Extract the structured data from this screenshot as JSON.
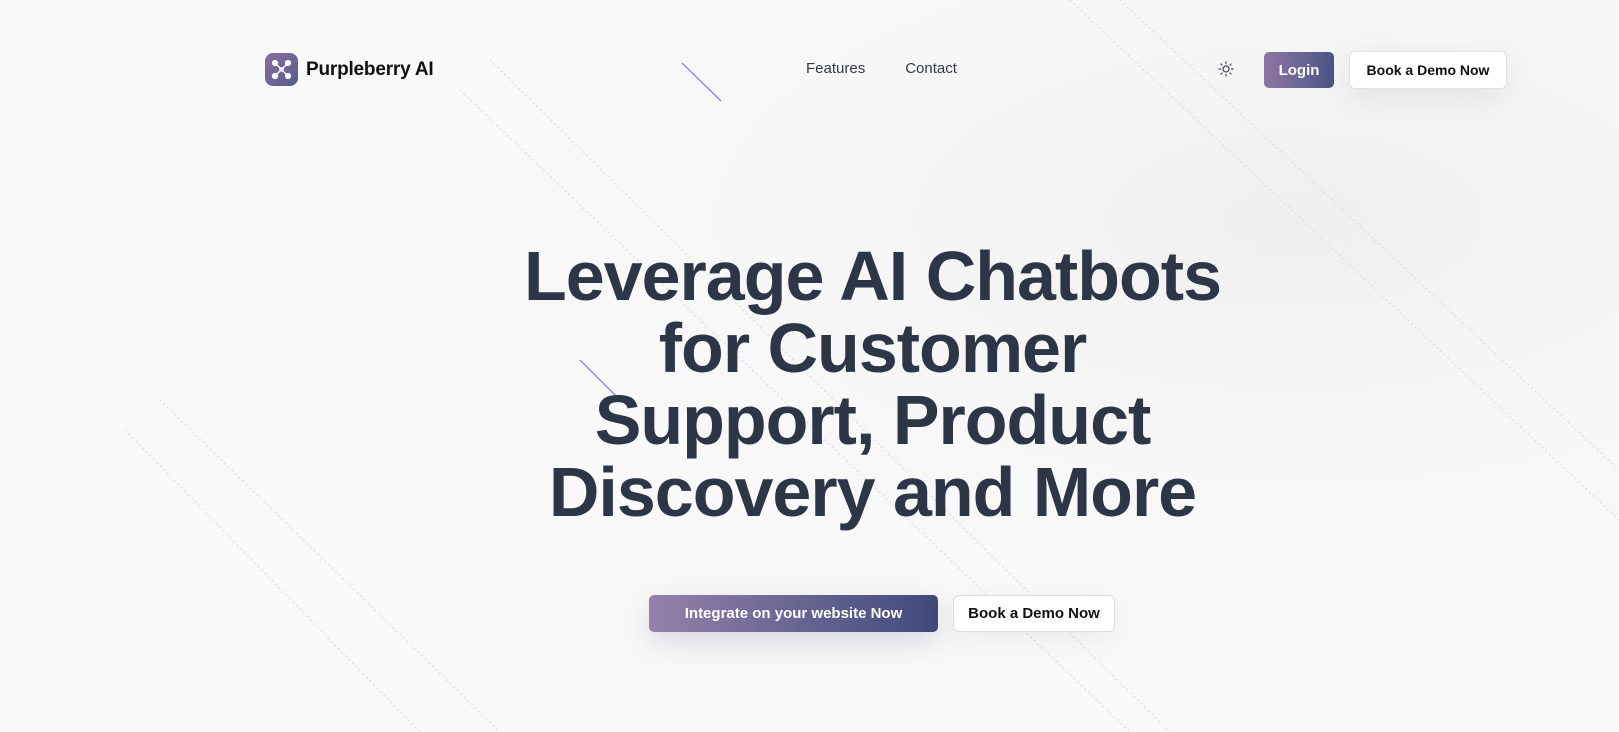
{
  "nav": {
    "brand_name": "Purpleberry AI",
    "logo_icon": "network-nodes-icon",
    "links": [
      {
        "label": "Features"
      },
      {
        "label": "Contact"
      }
    ],
    "theme_toggle_icon": "sun-icon",
    "login_label": "Login",
    "demo_label": "Book a Demo Now"
  },
  "hero": {
    "title_lines": [
      "Leverage AI Chatbots",
      "for Customer",
      "Support, Product",
      "Discovery and More"
    ],
    "primary_cta": "Integrate on your website Now",
    "secondary_cta": "Book a Demo Now"
  },
  "colors": {
    "background": "#f9f9f9",
    "heading": "#2c3646",
    "brand_gradient_start": "#9581ab",
    "brand_gradient_end": "#3f4a7a",
    "accent_line": "#5b6ee0"
  }
}
